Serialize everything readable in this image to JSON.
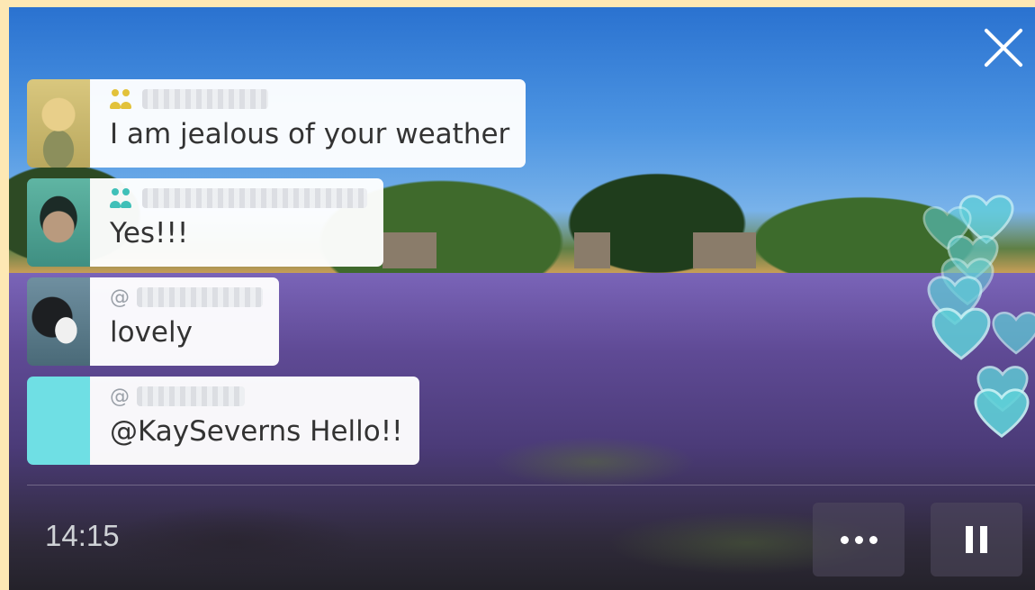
{
  "stream": {
    "elapsed_time": "14:15"
  },
  "colors": {
    "heart": "#5fd0d8",
    "heart_stroke": "#c9f4f6",
    "people_icon_yellow": "#e2c23a",
    "people_icon_teal": "#3fc0b8",
    "avatar_teal": "#6fdfe4"
  },
  "comments": [
    {
      "message": "I am jealous of your weather",
      "author_prefix": "",
      "badge_icon": "friends-icon",
      "avatar": "avatar-blonde-woman"
    },
    {
      "message": "Yes!!!",
      "author_prefix": "",
      "badge_icon": "friends-icon",
      "avatar": "avatar-dark-hair-woman"
    },
    {
      "message": "lovely",
      "author_prefix": "@",
      "badge_icon": "",
      "avatar": "avatar-cat"
    },
    {
      "message": "@KaySeverns Hello!!",
      "author_prefix": "@",
      "badge_icon": "",
      "avatar": "avatar-teal-placeholder"
    }
  ],
  "controls": {
    "more_icon": "more-dots-icon",
    "pause_icon": "pause-icon",
    "close_icon": "close-icon"
  }
}
